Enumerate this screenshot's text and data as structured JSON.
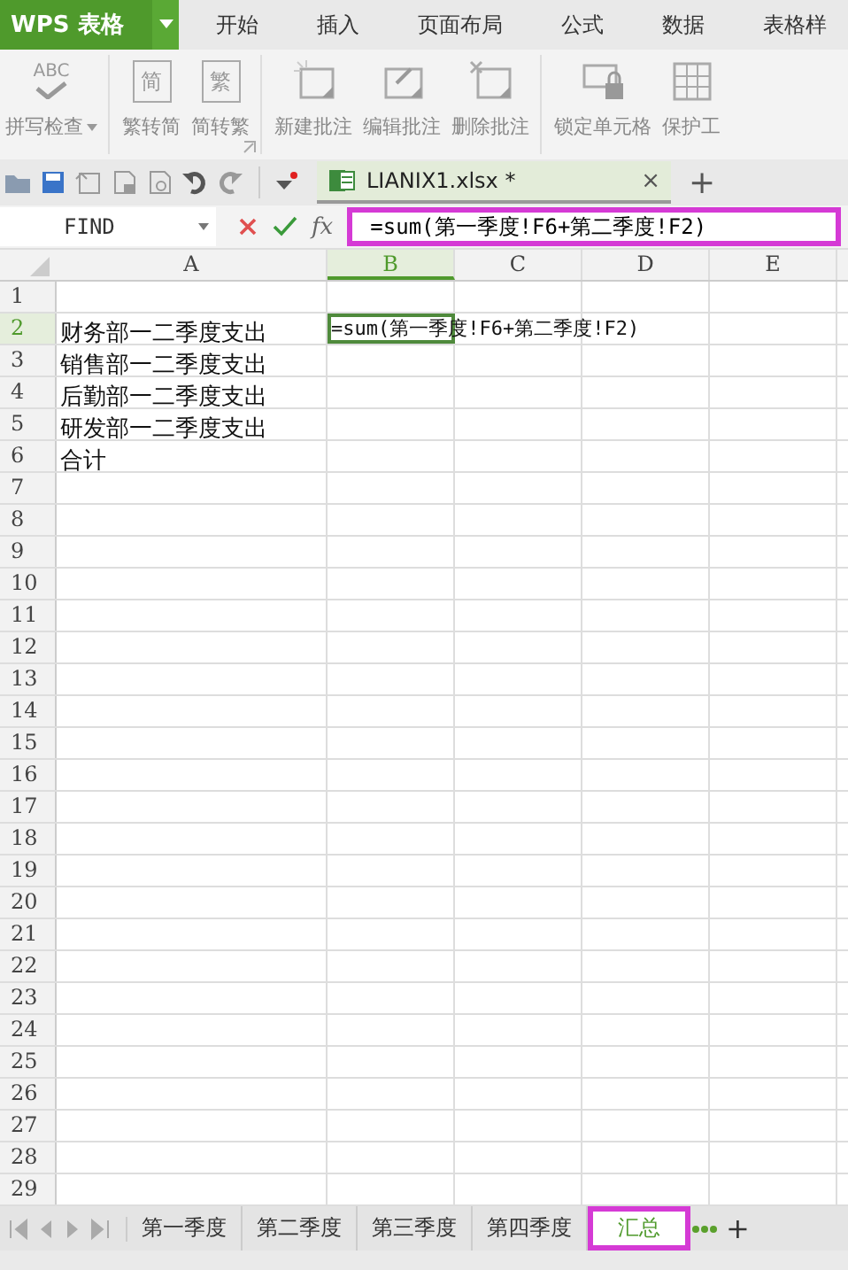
{
  "app": {
    "title": "WPS 表格"
  },
  "menu_tabs": [
    {
      "label": "开始",
      "selected": false
    },
    {
      "label": "插入",
      "selected": false
    },
    {
      "label": "页面布局",
      "selected": false
    },
    {
      "label": "公式",
      "selected": false
    },
    {
      "label": "数据",
      "selected": false
    },
    {
      "label": "表格样",
      "selected": false
    }
  ],
  "ribbon": [
    {
      "label": "拼写检查",
      "icon_text": "ABC",
      "dropdown": true,
      "group_end": true
    },
    {
      "label": "繁转简",
      "icon_text": "简",
      "dropdown": false,
      "group_end": false
    },
    {
      "label": "简转繁",
      "icon_text": "繁",
      "dropdown": false,
      "group_end": true
    },
    {
      "label": "新建批注",
      "dropdown": false,
      "group_end": false
    },
    {
      "label": "编辑批注",
      "dropdown": false,
      "group_end": false
    },
    {
      "label": "删除批注",
      "dropdown": false,
      "group_end": true
    },
    {
      "label": "锁定单元格",
      "dropdown": false,
      "group_end": false
    },
    {
      "label": "保护工",
      "dropdown": false,
      "group_end": false
    }
  ],
  "document_tab": {
    "name": "LIANIX1.xlsx *",
    "close": "×",
    "new": "+"
  },
  "name_box": {
    "value": "FIND"
  },
  "formula_bar": {
    "fx": "fx",
    "value": "=sum(第一季度!F6+第二季度!F2)",
    "highlighted": true
  },
  "columns": [
    {
      "label": "A",
      "selected": false
    },
    {
      "label": "B",
      "selected": true
    },
    {
      "label": "C",
      "selected": false
    },
    {
      "label": "D",
      "selected": false
    },
    {
      "label": "E",
      "selected": false
    }
  ],
  "rows": [
    {
      "number": "1",
      "selected": false,
      "cells": []
    },
    {
      "number": "2",
      "selected": true,
      "cells": [
        {
          "text": "财务部一二季度支出",
          "active": false
        },
        {
          "text": "=sum(第一季度!F6+第二季度!F2)",
          "active": true
        }
      ]
    },
    {
      "number": "3",
      "selected": false,
      "cells": [
        {
          "text": "销售部一二季度支出",
          "active": false
        }
      ]
    },
    {
      "number": "4",
      "selected": false,
      "cells": [
        {
          "text": "后勤部一二季度支出",
          "active": false
        }
      ]
    },
    {
      "number": "5",
      "selected": false,
      "cells": [
        {
          "text": "研发部一二季度支出",
          "active": false
        }
      ]
    },
    {
      "number": "6",
      "selected": false,
      "cells": [
        {
          "text": "合计",
          "active": false
        }
      ]
    },
    {
      "number": "7",
      "selected": false,
      "cells": []
    },
    {
      "number": "8",
      "selected": false,
      "cells": []
    },
    {
      "number": "9",
      "selected": false,
      "cells": []
    },
    {
      "number": "10",
      "selected": false,
      "cells": []
    },
    {
      "number": "11",
      "selected": false,
      "cells": []
    },
    {
      "number": "12",
      "selected": false,
      "cells": []
    },
    {
      "number": "13",
      "selected": false,
      "cells": []
    },
    {
      "number": "14",
      "selected": false,
      "cells": []
    },
    {
      "number": "15",
      "selected": false,
      "cells": []
    },
    {
      "number": "16",
      "selected": false,
      "cells": []
    },
    {
      "number": "17",
      "selected": false,
      "cells": []
    },
    {
      "number": "18",
      "selected": false,
      "cells": []
    },
    {
      "number": "19",
      "selected": false,
      "cells": []
    },
    {
      "number": "20",
      "selected": false,
      "cells": []
    },
    {
      "number": "21",
      "selected": false,
      "cells": []
    },
    {
      "number": "22",
      "selected": false,
      "cells": []
    },
    {
      "number": "23",
      "selected": false,
      "cells": []
    },
    {
      "number": "24",
      "selected": false,
      "cells": []
    },
    {
      "number": "25",
      "selected": false,
      "cells": []
    },
    {
      "number": "26",
      "selected": false,
      "cells": []
    },
    {
      "number": "27",
      "selected": false,
      "cells": []
    },
    {
      "number": "28",
      "selected": false,
      "cells": []
    },
    {
      "number": "29",
      "selected": false,
      "cells": []
    }
  ],
  "sheet_tabs": [
    {
      "label": "第一季度",
      "selected": false,
      "highlighted": false
    },
    {
      "label": "第二季度",
      "selected": false,
      "highlighted": false
    },
    {
      "label": "第三季度",
      "selected": false,
      "highlighted": false
    },
    {
      "label": "第四季度",
      "selected": false,
      "highlighted": false
    },
    {
      "label": "汇总",
      "selected": true,
      "highlighted": true
    }
  ],
  "sheet_add": "+"
}
